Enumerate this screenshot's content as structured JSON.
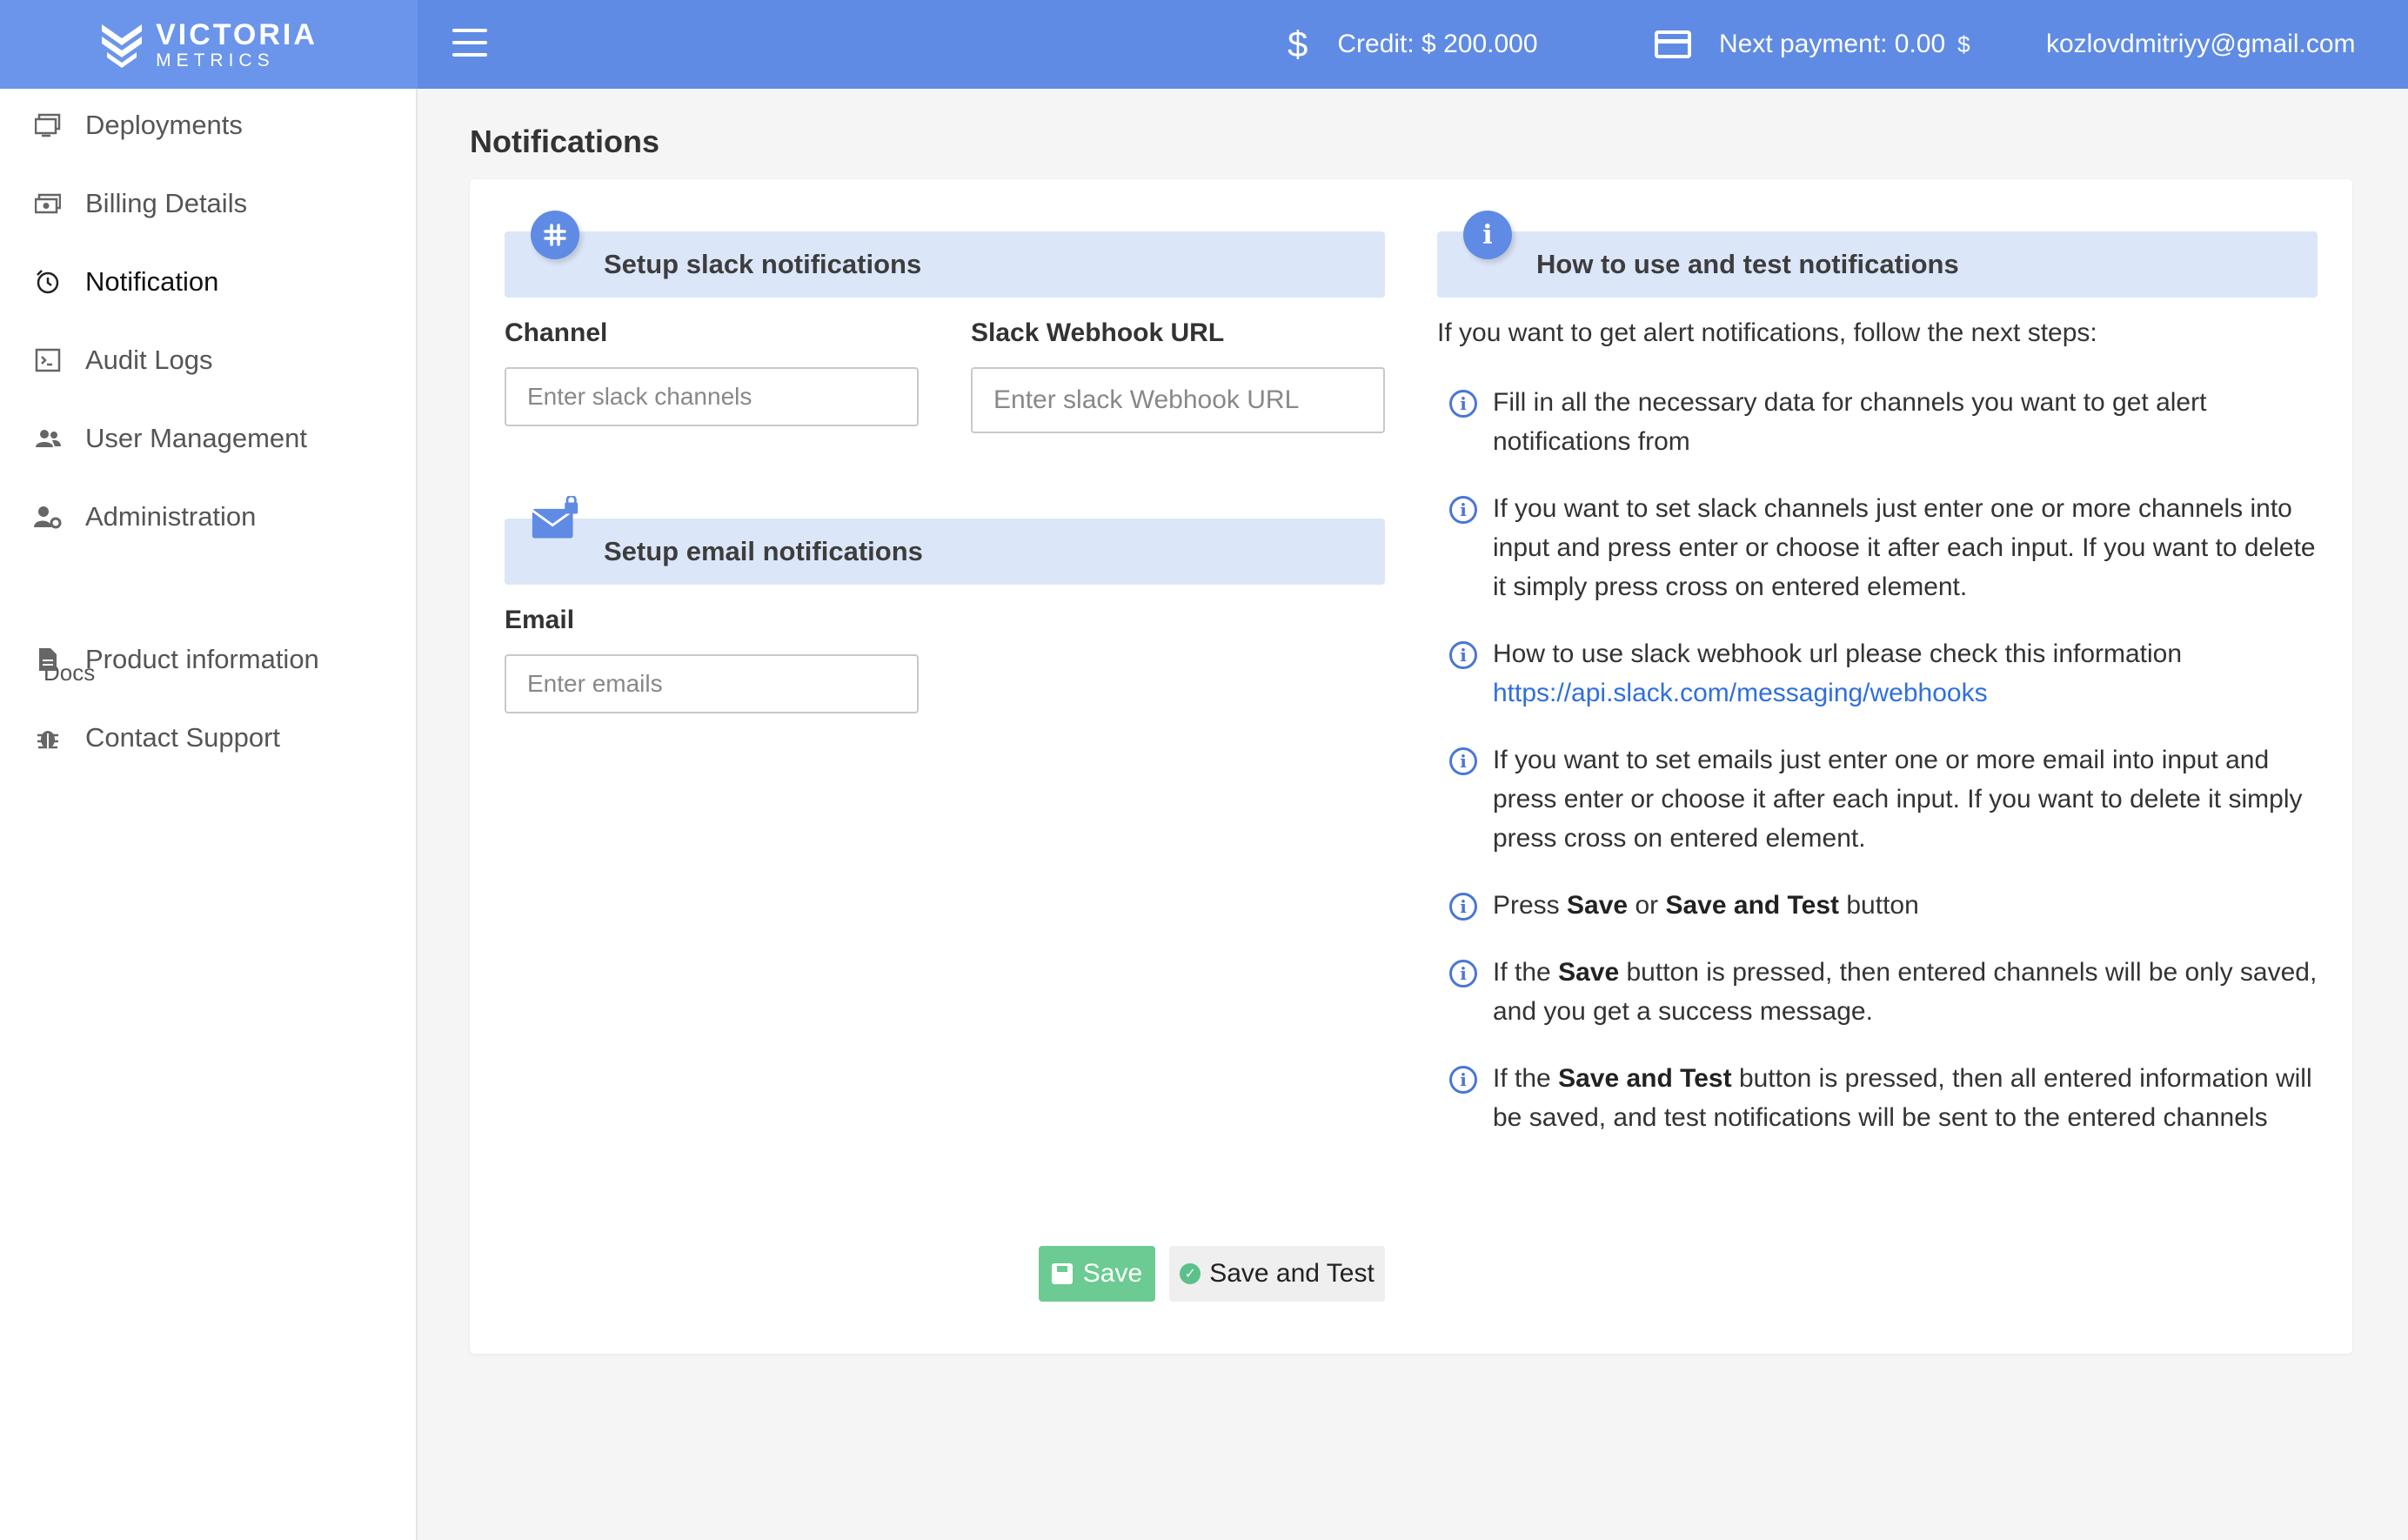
{
  "brand": {
    "line1": "VICTORIA",
    "line2": "METRICS"
  },
  "header": {
    "credit_icon": "$",
    "credit": "Credit: $ 200.000",
    "next_payment": "Next payment: 0.00",
    "next_payment_currency": "$",
    "user_email": "kozlovdmitriyy@gmail.com"
  },
  "sidebar": {
    "items": [
      {
        "label": "Deployments",
        "icon": "monitor-icon"
      },
      {
        "label": "Billing Details",
        "icon": "money-icon"
      },
      {
        "label": "Notification",
        "icon": "alarm-icon"
      },
      {
        "label": "Audit Logs",
        "icon": "terminal-icon"
      },
      {
        "label": "User Management",
        "icon": "users-icon"
      },
      {
        "label": "Administration",
        "icon": "user-gear-icon"
      }
    ],
    "docs_label": "Docs",
    "docs_items": [
      {
        "label": "Product information",
        "icon": "document-icon"
      },
      {
        "label": "Contact Support",
        "icon": "bug-icon"
      }
    ]
  },
  "page": {
    "title": "Notifications"
  },
  "slack": {
    "title": "Setup slack notifications",
    "channel_label": "Channel",
    "channel_placeholder": "Enter slack channels",
    "webhook_label": "Slack Webhook URL",
    "webhook_placeholder": "Enter slack Webhook URL"
  },
  "email": {
    "title": "Setup email notifications",
    "label": "Email",
    "placeholder": "Enter emails"
  },
  "howto": {
    "title": "How to use and test notifications",
    "intro": "If you want to get alert notifications, follow the next steps:",
    "steps": [
      {
        "text": "Fill in all the necessary data for channels you want to get alert notifications from"
      },
      {
        "text": "If you want to set slack channels just enter one or more channels into input and press enter or choose it after each input. If you want to delete it simply press cross on entered element."
      },
      {
        "text": "How to use slack webhook url please check this information",
        "link": "https://api.slack.com/messaging/webhooks"
      },
      {
        "text": "If you want to set emails just enter one or more email into input and press enter or choose it after each input. If you want to delete it simply press cross on entered element."
      },
      {
        "prefix": "Press",
        "bold1": "Save",
        "middle": "or",
        "bold2": "Save and Test",
        "suffix": "button"
      },
      {
        "prefix": "If the",
        "bold1": "Save",
        "suffix": "button is pressed, then entered channels will be only saved, and you get a success message."
      },
      {
        "prefix": "If the",
        "bold1": "Save and Test",
        "suffix": "button is pressed, then all entered information will be saved, and test notifications will be sent to the entered channels"
      }
    ]
  },
  "actions": {
    "save": "Save",
    "save_and_test": "Save and Test"
  },
  "colors": {
    "header": "#5f8be4",
    "section_bg": "#dce6f9",
    "save_button": "#6bcb92",
    "link": "#2f6fde"
  }
}
